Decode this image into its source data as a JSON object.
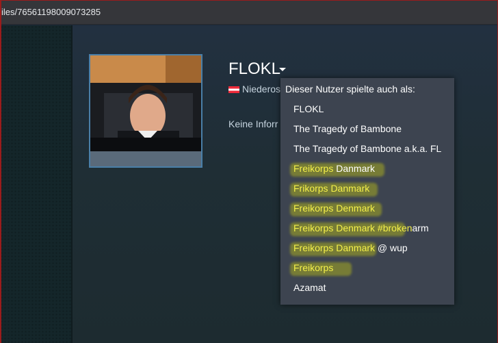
{
  "browser": {
    "url": "iles/76561198009073285"
  },
  "profile": {
    "name": "FLOKL",
    "location": "Niederos",
    "summary": "Keine Inforr"
  },
  "dropdown": {
    "header": "Dieser Nutzer spielte auch als:",
    "aliases": [
      {
        "parts": [
          "FLOKL"
        ]
      },
      {
        "parts": [
          "The Tragedy of Bambone"
        ]
      },
      {
        "parts": [
          "The Tragedy of Bambone a.k.a. FL"
        ]
      },
      {
        "parts": [
          "Freikorps",
          " Danmark"
        ]
      },
      {
        "parts": [
          "Frikorps Danmark"
        ]
      },
      {
        "parts": [
          "Freikorps Denmark"
        ]
      },
      {
        "parts": [
          "Freikorps Denmark #broken",
          "arm"
        ]
      },
      {
        "parts": [
          "Freikorps Danmark",
          " @ wup"
        ]
      },
      {
        "parts": [
          "Freikorps"
        ]
      },
      {
        "parts": [
          "Azamat"
        ]
      }
    ]
  },
  "colors": {
    "highlight": "#f2f200",
    "highlight_text": "#f4f04a",
    "dropdown_bg": "#3d4450",
    "avatar_border": "#4a7fa8"
  }
}
